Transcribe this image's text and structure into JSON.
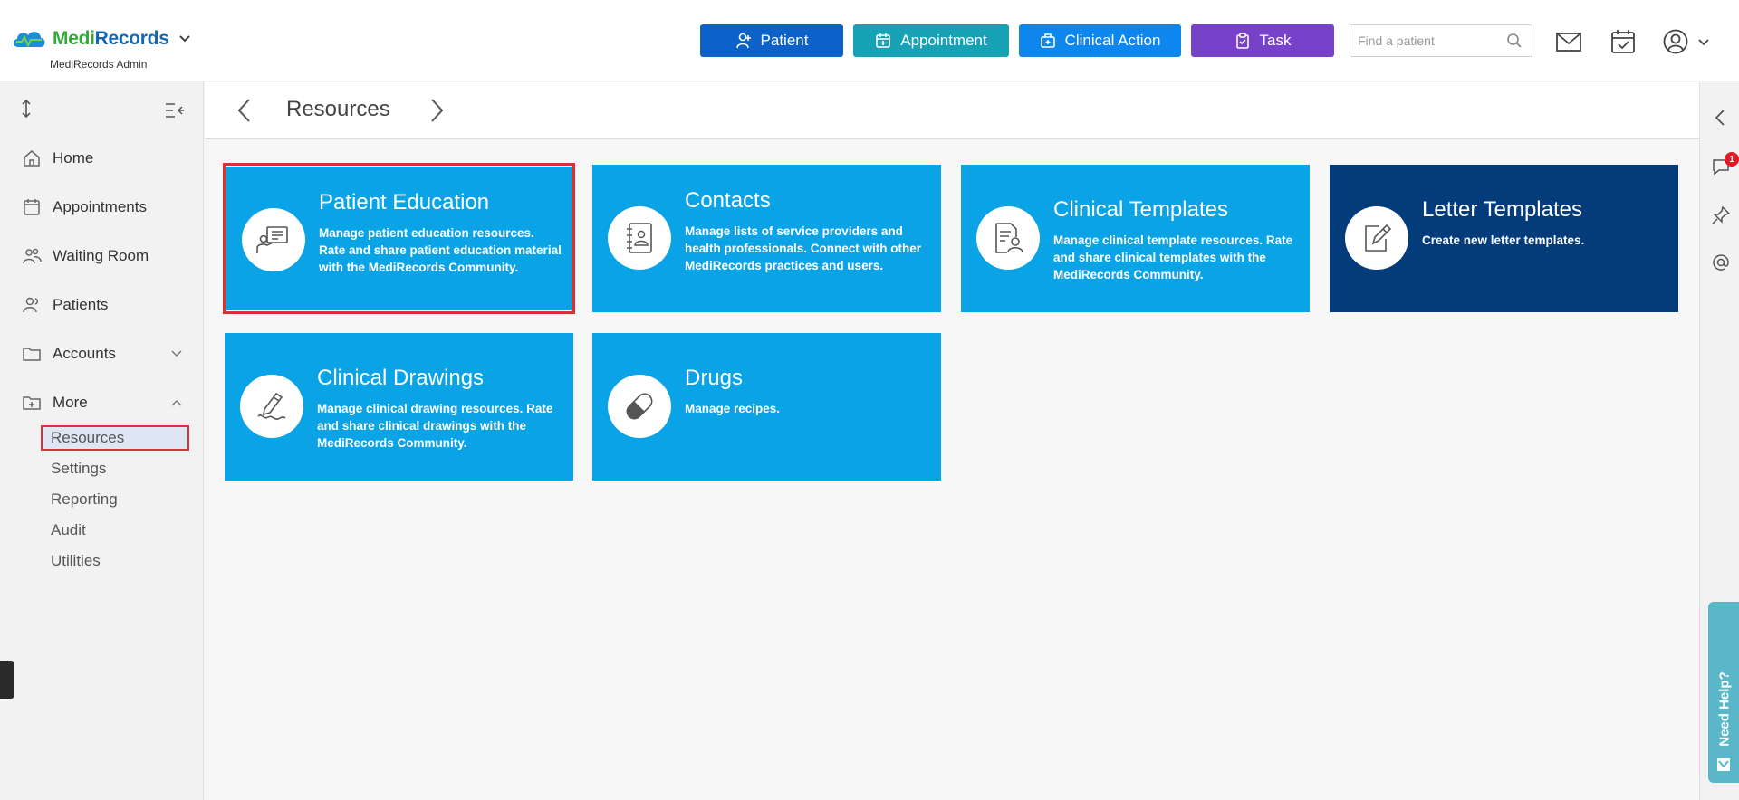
{
  "app": {
    "brand_part1": "Medi",
    "brand_part2": "Records",
    "subtitle": "MediRecords Admin"
  },
  "header": {
    "buttons": [
      {
        "label": "Patient",
        "icon": "add-person-icon"
      },
      {
        "label": "Appointment",
        "icon": "calendar-add-icon"
      },
      {
        "label": "Clinical Action",
        "icon": "medical-bag-icon"
      },
      {
        "label": "Task",
        "icon": "clipboard-icon"
      }
    ],
    "search_placeholder": "Find a patient"
  },
  "sidebar": {
    "items": [
      {
        "label": "Home",
        "icon": "home-icon"
      },
      {
        "label": "Appointments",
        "icon": "calendar-icon"
      },
      {
        "label": "Waiting Room",
        "icon": "people-icon"
      },
      {
        "label": "Patients",
        "icon": "person-icon"
      },
      {
        "label": "Accounts",
        "icon": "folder-icon"
      },
      {
        "label": "More",
        "icon": "folder-plus-icon"
      }
    ],
    "sub_items": [
      "Resources",
      "Settings",
      "Reporting",
      "Audit",
      "Utilities"
    ]
  },
  "page": {
    "title": "Resources"
  },
  "tiles": [
    {
      "title": "Patient Education",
      "desc": "Manage patient education resources. Rate and share patient education material with the MediRecords Community.",
      "icon": "presentation-icon"
    },
    {
      "title": "Contacts",
      "desc": "Manage lists of service providers and health professionals. Connect with other MediRecords practices and users.",
      "icon": "address-book-icon"
    },
    {
      "title": "Clinical Templates",
      "desc": "Manage clinical template resources. Rate and share clinical templates with the MediRecords Community.",
      "icon": "document-person-icon"
    },
    {
      "title": "Letter Templates",
      "desc": "Create new letter templates.",
      "icon": "edit-document-icon"
    },
    {
      "title": "Clinical Drawings",
      "desc": "Manage clinical drawing resources. Rate and share clinical drawings with the MediRecords Community.",
      "icon": "pencil-drawing-icon"
    },
    {
      "title": "Drugs",
      "desc": "Manage recipes.",
      "icon": "pill-icon"
    }
  ],
  "right_rail": {
    "chat_badge": "1",
    "help_label": "Need Help?"
  },
  "colors": {
    "tile_blue": "#0aa3e6",
    "tile_dark": "#033b7b",
    "highlight": "#d7323a"
  }
}
